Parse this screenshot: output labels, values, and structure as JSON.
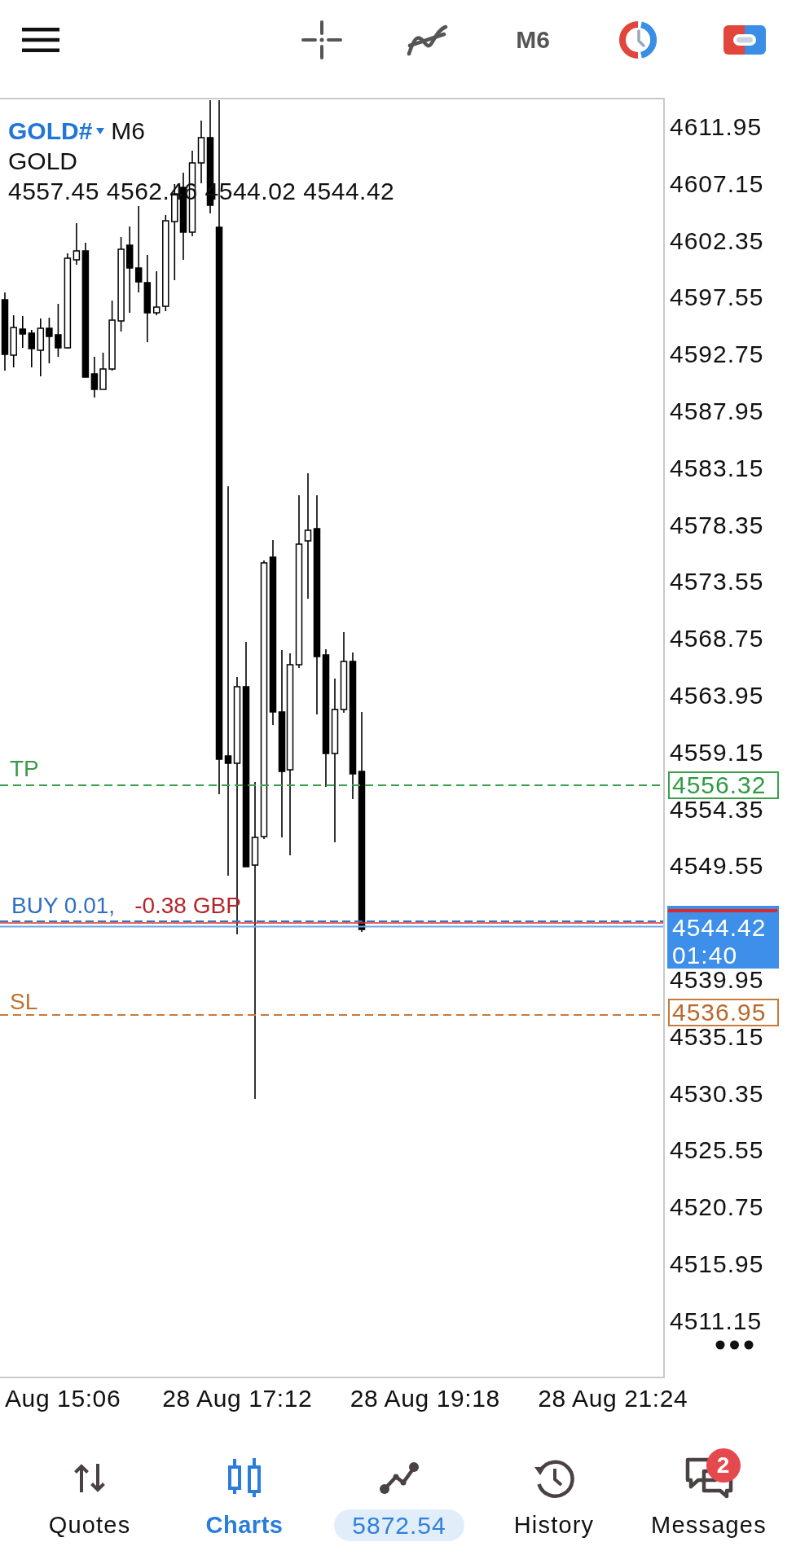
{
  "toolbar": {
    "timeframe": "M6"
  },
  "chart": {
    "symbol": "GOLD#",
    "timeframe": "M6",
    "description": "GOLD",
    "ohlc": "4557.45 4562.46 4544.02 4544.42",
    "price_axis": [
      "4611.95",
      "4607.15",
      "4602.35",
      "4597.55",
      "4592.75",
      "4587.95",
      "4583.15",
      "4578.35",
      "4573.55",
      "4568.75",
      "4563.95",
      "4559.15",
      "4554.35",
      "4549.55",
      "4539.95",
      "4535.15",
      "4530.35",
      "4525.55",
      "4520.75",
      "4515.95",
      "4511.15"
    ],
    "time_axis": [
      "Aug 15:06",
      "28 Aug 17:12",
      "28 Aug 19:18",
      "28 Aug 21:24"
    ],
    "take_profit": {
      "label": "TP",
      "price": "4556.32"
    },
    "position": {
      "label": "BUY 0.01,",
      "profit": "-0.38 GBP"
    },
    "current_price": {
      "price": "4544.42",
      "countdown": "01:40"
    },
    "stop_loss": {
      "label": "SL",
      "price": "4536.95"
    }
  },
  "nav": [
    {
      "label": "Quotes",
      "selected": false,
      "kind": "tab"
    },
    {
      "label": "Charts",
      "selected": true,
      "kind": "tab"
    },
    {
      "label": "5872.54",
      "selected": false,
      "kind": "balance"
    },
    {
      "label": "History",
      "selected": false,
      "kind": "tab"
    },
    {
      "label": "Messages",
      "selected": false,
      "kind": "tab",
      "badge": "2"
    }
  ]
}
